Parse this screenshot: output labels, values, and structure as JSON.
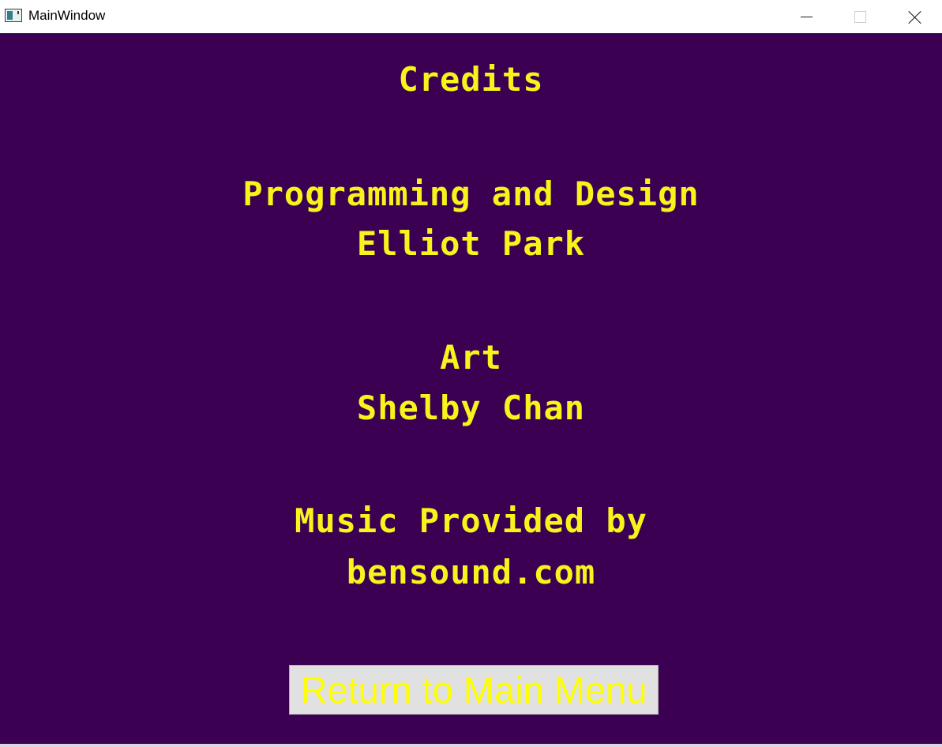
{
  "window": {
    "title": "MainWindow",
    "controls": {
      "minimize": "minimize-icon",
      "maximize": "maximize-icon",
      "close": "close-icon"
    }
  },
  "credits": {
    "heading": "Credits",
    "programming_role": "Programming and Design",
    "programming_name": "Elliot Park",
    "art_role": "Art",
    "art_name": "Shelby Chan",
    "music_role": "Music Provided by",
    "music_source": "bensound.com"
  },
  "buttons": {
    "return_label": "Return to Main Menu"
  },
  "colors": {
    "background": "#3b0051",
    "text": "#f7f41c",
    "button_face": "#e1e1e1",
    "button_text": "#ffff00"
  }
}
